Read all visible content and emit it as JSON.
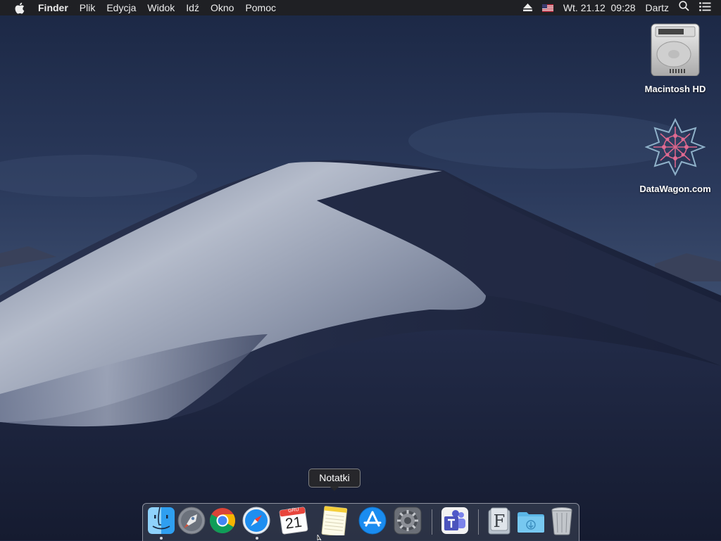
{
  "menubar": {
    "app_name": "Finder",
    "items": [
      "Plik",
      "Edycja",
      "Widok",
      "Idź",
      "Okno",
      "Pomoc"
    ],
    "clock": "Wt. 21.12  09:28",
    "user": "Dartz"
  },
  "desktop": {
    "icons": [
      {
        "label": "Macintosh HD",
        "icon": "hard-drive-icon"
      },
      {
        "label": "DataWagon.com",
        "icon": "datawagon-logo-icon"
      }
    ]
  },
  "tooltip": {
    "text": "Notatki"
  },
  "dock": {
    "calendar": {
      "month": "GRU",
      "day": "21"
    },
    "items": [
      {
        "name": "Finder",
        "icon": "finder-icon",
        "running": true
      },
      {
        "name": "Launchpad",
        "icon": "launchpad-icon",
        "running": false
      },
      {
        "name": "Google Chrome",
        "icon": "chrome-icon",
        "running": false
      },
      {
        "name": "Safari",
        "icon": "safari-icon",
        "running": true
      },
      {
        "name": "Kalendarz",
        "icon": "calendar-icon",
        "running": false
      },
      {
        "name": "Notatki",
        "icon": "notes-icon",
        "running": false
      },
      {
        "name": "App Store",
        "icon": "app-store-icon",
        "running": false
      },
      {
        "name": "Preferencje systemowe",
        "icon": "system-preferences-icon",
        "running": false
      },
      {
        "name": "Microsoft Teams",
        "icon": "teams-icon",
        "running": false
      },
      {
        "name": "Fonty",
        "icon": "font-folder-icon",
        "running": false
      },
      {
        "name": "Pobrane",
        "icon": "downloads-folder-icon",
        "running": false
      },
      {
        "name": "Kosz",
        "icon": "trash-icon",
        "running": false
      }
    ]
  },
  "colors": {
    "menubar_bg": "#202022",
    "sky_top": "#1e2a45",
    "sky_mid": "#3a4c6e",
    "dune_light": "#aab3c4",
    "dune_dark": "#1a2036"
  }
}
